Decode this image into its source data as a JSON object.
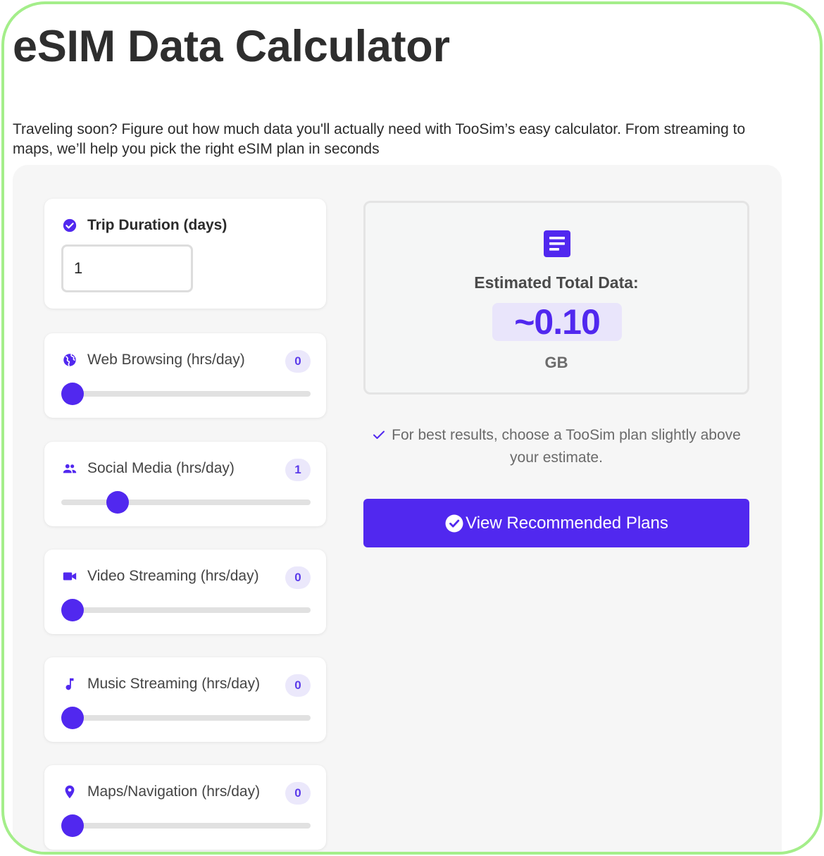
{
  "page": {
    "title": "eSIM Data Calculator",
    "intro": "Traveling soon? Figure out how much data you'll actually need with TooSim’s easy calculator. From streaming to maps, we’ll help you pick the right eSIM plan in seconds"
  },
  "calculator": {
    "trip": {
      "label": "Trip Duration (days)",
      "value": "1",
      "icon": "check-circle-icon"
    },
    "sliders": [
      {
        "label": "Web Browsing (hrs/day)",
        "value": "0",
        "fraction": 0.0,
        "icon": "globe-icon"
      },
      {
        "label": "Social Media (hrs/day)",
        "value": "1",
        "fraction": 0.2,
        "icon": "people-icon"
      },
      {
        "label": "Video Streaming (hrs/day)",
        "value": "0",
        "fraction": 0.0,
        "icon": "video-camera-icon"
      },
      {
        "label": "Music Streaming (hrs/day)",
        "value": "0",
        "fraction": 0.0,
        "icon": "music-note-icon"
      },
      {
        "label": "Maps/Navigation (hrs/day)",
        "value": "0",
        "fraction": 0.0,
        "icon": "map-pin-icon"
      }
    ]
  },
  "result": {
    "label": "Estimated Total Data:",
    "value": "~0.10",
    "unit": "GB",
    "icon": "document-icon"
  },
  "tip": {
    "text": "For best results, choose a TooSim plan slightly above your estimate.",
    "icon": "checkmark-icon"
  },
  "cta": {
    "label": "View Recommended Plans",
    "icon": "check-circle-icon"
  },
  "colors": {
    "accent": "#5128ef",
    "frame_border": "#a4ee8a",
    "badge_bg": "#ebe8fb",
    "panel_bg": "#f6f6f6"
  }
}
